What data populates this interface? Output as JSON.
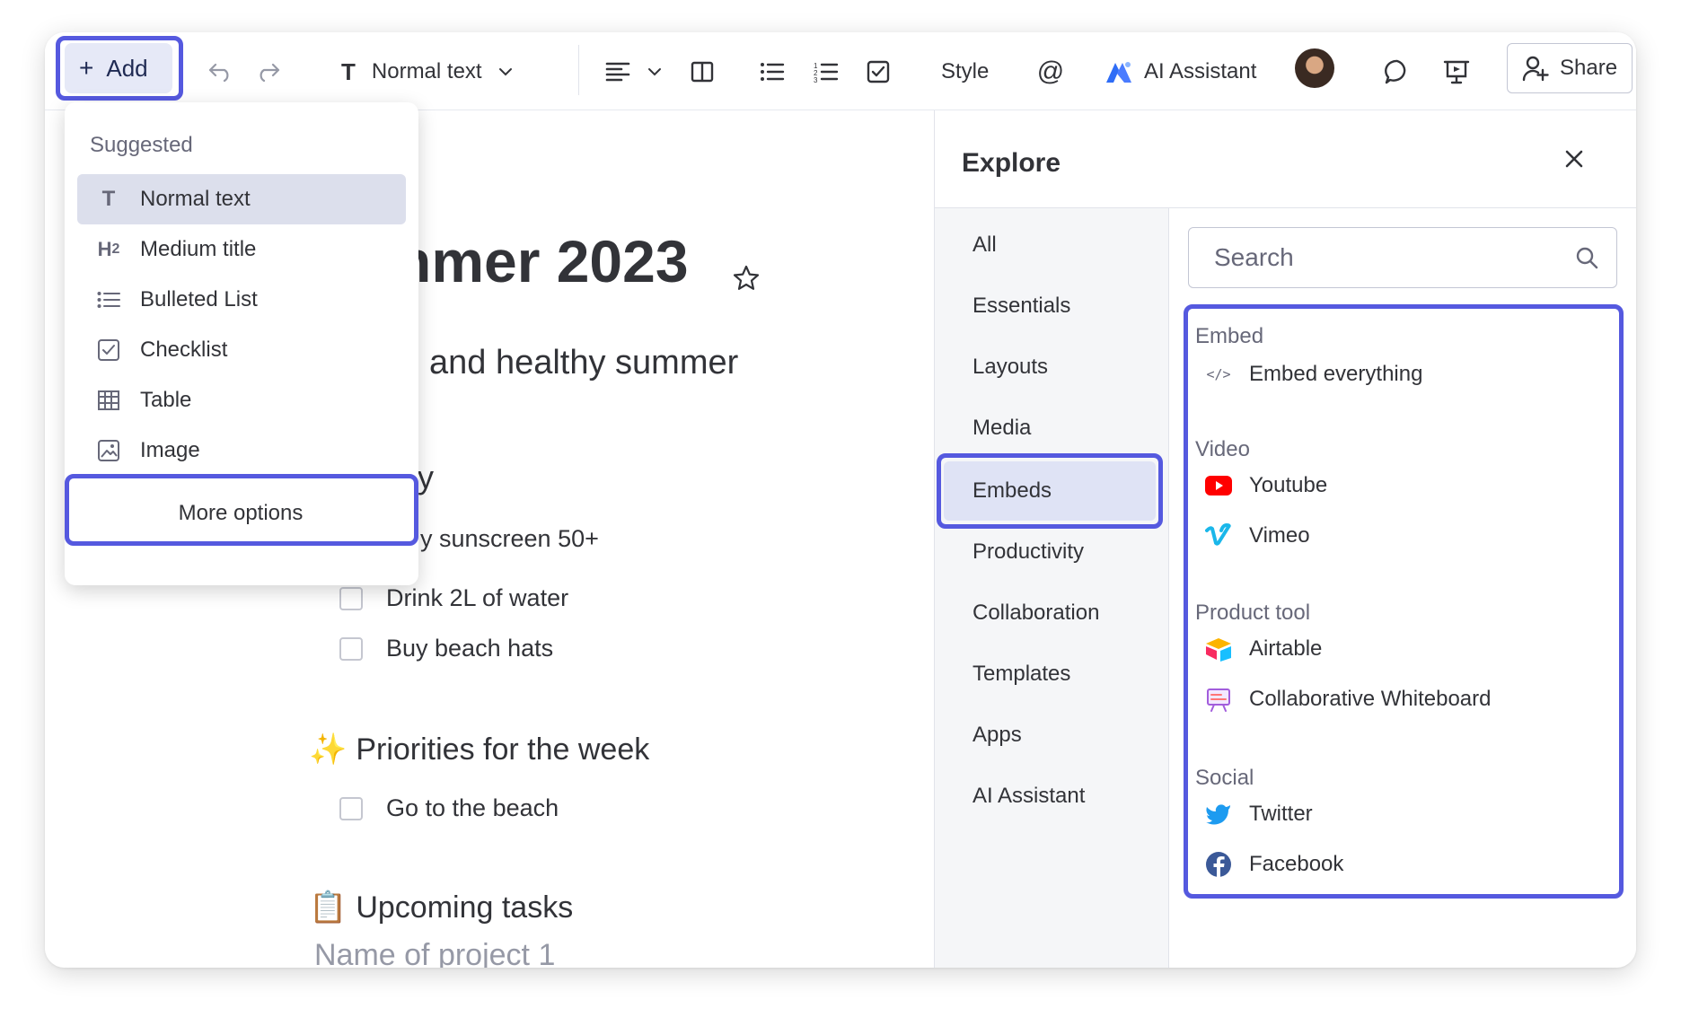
{
  "toolbar": {
    "add_label": "Add",
    "text_style": "Normal text",
    "style_label": "Style",
    "ai_label": "AI Assistant",
    "share_label": "Share"
  },
  "add_menu": {
    "heading": "Suggested",
    "items": [
      {
        "icon": "T",
        "label": "Normal text",
        "active": true
      },
      {
        "icon": "H2",
        "label": "Medium title"
      },
      {
        "icon": "bulleted-list-icon",
        "label": "Bulleted List"
      },
      {
        "icon": "checklist-icon",
        "label": "Checklist"
      },
      {
        "icon": "table-icon",
        "label": "Table"
      },
      {
        "icon": "image-icon",
        "label": "Image"
      }
    ],
    "more_options": "More options"
  },
  "document": {
    "title_fragment": "nmer 2023",
    "subtitle_fragment": "and healthy summer",
    "fragment_y": "y",
    "fragment_sunscreen": "y sunscreen 50+",
    "tasks": [
      "Drink 2L of water",
      "Buy beach hats"
    ],
    "section_priorities": {
      "emoji": "✨",
      "title": "Priorities for the week"
    },
    "priority_tasks": [
      "Go to the beach"
    ],
    "section_upcoming": {
      "emoji": "📋",
      "title": "Upcoming tasks"
    },
    "project_placeholder": "Name of project 1"
  },
  "explore": {
    "title": "Explore",
    "nav": [
      "All",
      "Essentials",
      "Layouts",
      "Media",
      "Embeds",
      "Productivity",
      "Collaboration",
      "Templates",
      "Apps",
      "AI Assistant"
    ],
    "active_nav": "Embeds",
    "search_placeholder": "Search",
    "groups": {
      "embed": {
        "label": "Embed",
        "items": [
          "Embed everything"
        ]
      },
      "video": {
        "label": "Video",
        "items": [
          "Youtube",
          "Vimeo"
        ]
      },
      "product": {
        "label": "Product tool",
        "items": [
          "Airtable",
          "Collaborative Whiteboard"
        ]
      },
      "social": {
        "label": "Social",
        "items": [
          "Twitter",
          "Facebook"
        ]
      }
    }
  },
  "colors": {
    "highlight": "#5559df",
    "add_bg": "#e6e9f7",
    "active_nav": "#dfe3f5",
    "youtube": "#ff0000",
    "vimeo": "#1ab7ea",
    "twitter": "#1d9bf0",
    "facebook": "#3b5998"
  }
}
